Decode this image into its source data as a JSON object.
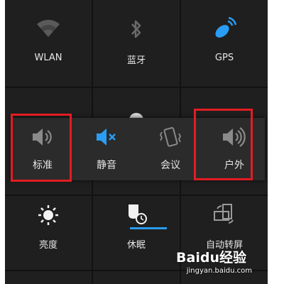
{
  "quick_settings": {
    "row1": [
      {
        "label": "WLAN",
        "icon": "wifi-icon"
      },
      {
        "label": "蓝牙",
        "icon": "bluetooth-icon"
      },
      {
        "label": "GPS",
        "icon": "gps-icon"
      }
    ],
    "row3": [
      {
        "label": "亮度",
        "icon": "brightness-icon"
      },
      {
        "label": "休眠",
        "icon": "sleep-timer-icon"
      },
      {
        "label": "自动转屏",
        "icon": "auto-rotate-icon"
      }
    ]
  },
  "sound_popup": {
    "modes": [
      {
        "label": "标准",
        "icon": "volume-icon",
        "highlighted": true
      },
      {
        "label": "静音",
        "icon": "mute-icon",
        "highlighted": false
      },
      {
        "label": "会议",
        "icon": "vibrate-icon",
        "highlighted": false
      },
      {
        "label": "户外",
        "icon": "loud-volume-icon",
        "highlighted": true
      }
    ]
  },
  "watermark": {
    "brand": "Baidu经验",
    "url": "jingyan.baidu.com"
  },
  "colors": {
    "accent_blue": "#2a9df4",
    "highlight_red": "#e21c23",
    "tile_bg": "#1f1f1f",
    "icon_gray": "#8a8a8a"
  }
}
